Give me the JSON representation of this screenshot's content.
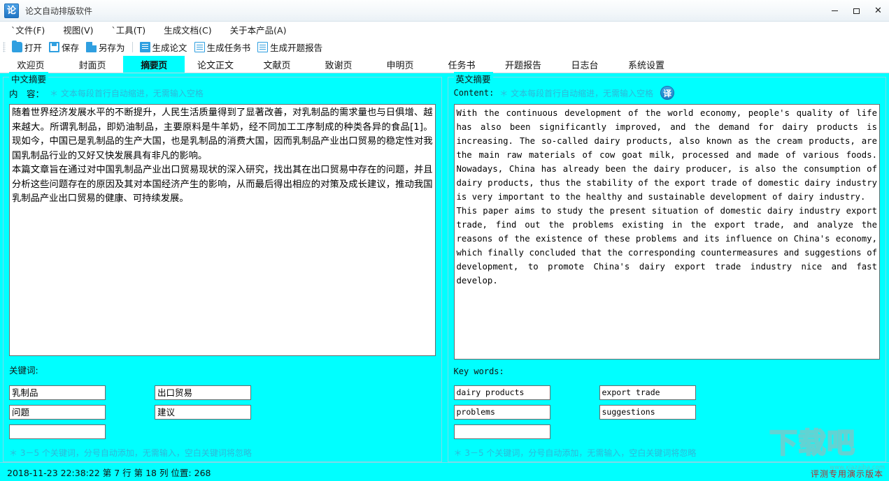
{
  "window": {
    "logo_text": "论",
    "title": "论文自动排版软件",
    "controls": {
      "minimize": "minimize-icon",
      "maximize": "maximize-icon",
      "close": "✕"
    }
  },
  "menubar": {
    "items": [
      {
        "label": "`文件(F)"
      },
      {
        "label": "视图(V)"
      },
      {
        "label": "`工具(T)"
      },
      {
        "label": "生成文档(C)"
      },
      {
        "label": "关于本产品(A)"
      }
    ]
  },
  "toolbar": {
    "items": [
      {
        "label": "打开",
        "icon": "folder-open-icon"
      },
      {
        "label": "保存",
        "icon": "save-icon"
      },
      {
        "label": "另存为",
        "icon": "save-as-icon"
      },
      {
        "label": "生成论文",
        "icon": "document-solid-icon"
      },
      {
        "label": "生成任务书",
        "icon": "document-icon"
      },
      {
        "label": "生成开题报告",
        "icon": "document-icon"
      }
    ]
  },
  "tabs": [
    {
      "label": "欢迎页",
      "active": false
    },
    {
      "label": "封面页",
      "active": false
    },
    {
      "label": "摘要页",
      "active": true
    },
    {
      "label": "论文正文",
      "active": false
    },
    {
      "label": "文献页",
      "active": false
    },
    {
      "label": "致谢页",
      "active": false
    },
    {
      "label": "申明页",
      "active": false
    },
    {
      "label": "任务书",
      "active": false
    },
    {
      "label": "开题报告",
      "active": false
    },
    {
      "label": "日志台",
      "active": false
    },
    {
      "label": "系统设置",
      "active": false
    }
  ],
  "chinese_panel": {
    "legend": "中文摘要",
    "content_label": "内　容：",
    "content_hint": "＊ 文本每段首行自动缩进，无需输入空格",
    "abstract_paragraph_1": "随着世界经济发展水平的不断提升，人民生活质量得到了显著改善，对乳制品的需求量也与日俱增、越来越大。所谓乳制品，即奶油制品，主要原料是牛羊奶，经不同加工工序制成的种类各异的食品[1]。现如今，中国已是乳制品的生产大国，也是乳制品的消费大国，因而乳制品产业出口贸易的稳定性对我国乳制品行业的又好又快发展具有非凡的影响。",
    "abstract_paragraph_2": "本篇文章旨在通过对中国乳制品产业出口贸易现状的深入研究，找出其在出口贸易中存在的问题，并且分析这些问题存在的原因及其对本国经济产生的影响，从而最后得出相应的对策及成长建议，推动我国乳制品产业出口贸易的健康、可持续发展。",
    "keywords_title": "关键词:",
    "keywords": [
      "乳制品",
      "出口贸易",
      "问题",
      "建议",
      ""
    ],
    "keywords_hint": "＊ 3－5 个关键词，分号自动添加，无需输入，空白关键词将忽略"
  },
  "english_panel": {
    "legend": "英文摘要",
    "content_label": "Content:",
    "content_hint": "＊ 文本每段首行自动缩进，无需输入空格",
    "translate_button": "译",
    "abstract_paragraph_1": "With the continuous development of the world economy, people's quality of life has also been significantly improved, and the demand for dairy products is increasing. The so-called dairy products, also known as the cream products, are the main raw materials of cow goat milk, processed and made of various foods. Nowadays, China has already been the dairy producer, is also the consumption of dairy products, thus the stability of the export trade of domestic dairy industry is very important to the healthy and sustainable development of dairy industry.",
    "abstract_paragraph_2": "This paper aims to study the present situation of domestic dairy industry export trade, find out the problems existing in the export trade, and analyze the reasons of the existence of these problems and its influence on China's economy, which finally concluded that the corresponding countermeasures and suggestions of development, to promote China's dairy export trade industry nice and fast develop.",
    "keywords_title": "Key words:",
    "keywords": [
      "dairy products",
      "export trade",
      "problems",
      "suggestions",
      ""
    ],
    "keywords_hint": "＊ 3－5 个关键词，分号自动添加，无需输入，空白关键词将忽略"
  },
  "statusbar": {
    "text": "2018-11-23 22:38:22  第 7 行 第 18 列 位置:  268",
    "demo_label": "评测专用演示版本",
    "watermark_text": "下载吧",
    "watermark_url": "www.xiazaiba.com"
  }
}
